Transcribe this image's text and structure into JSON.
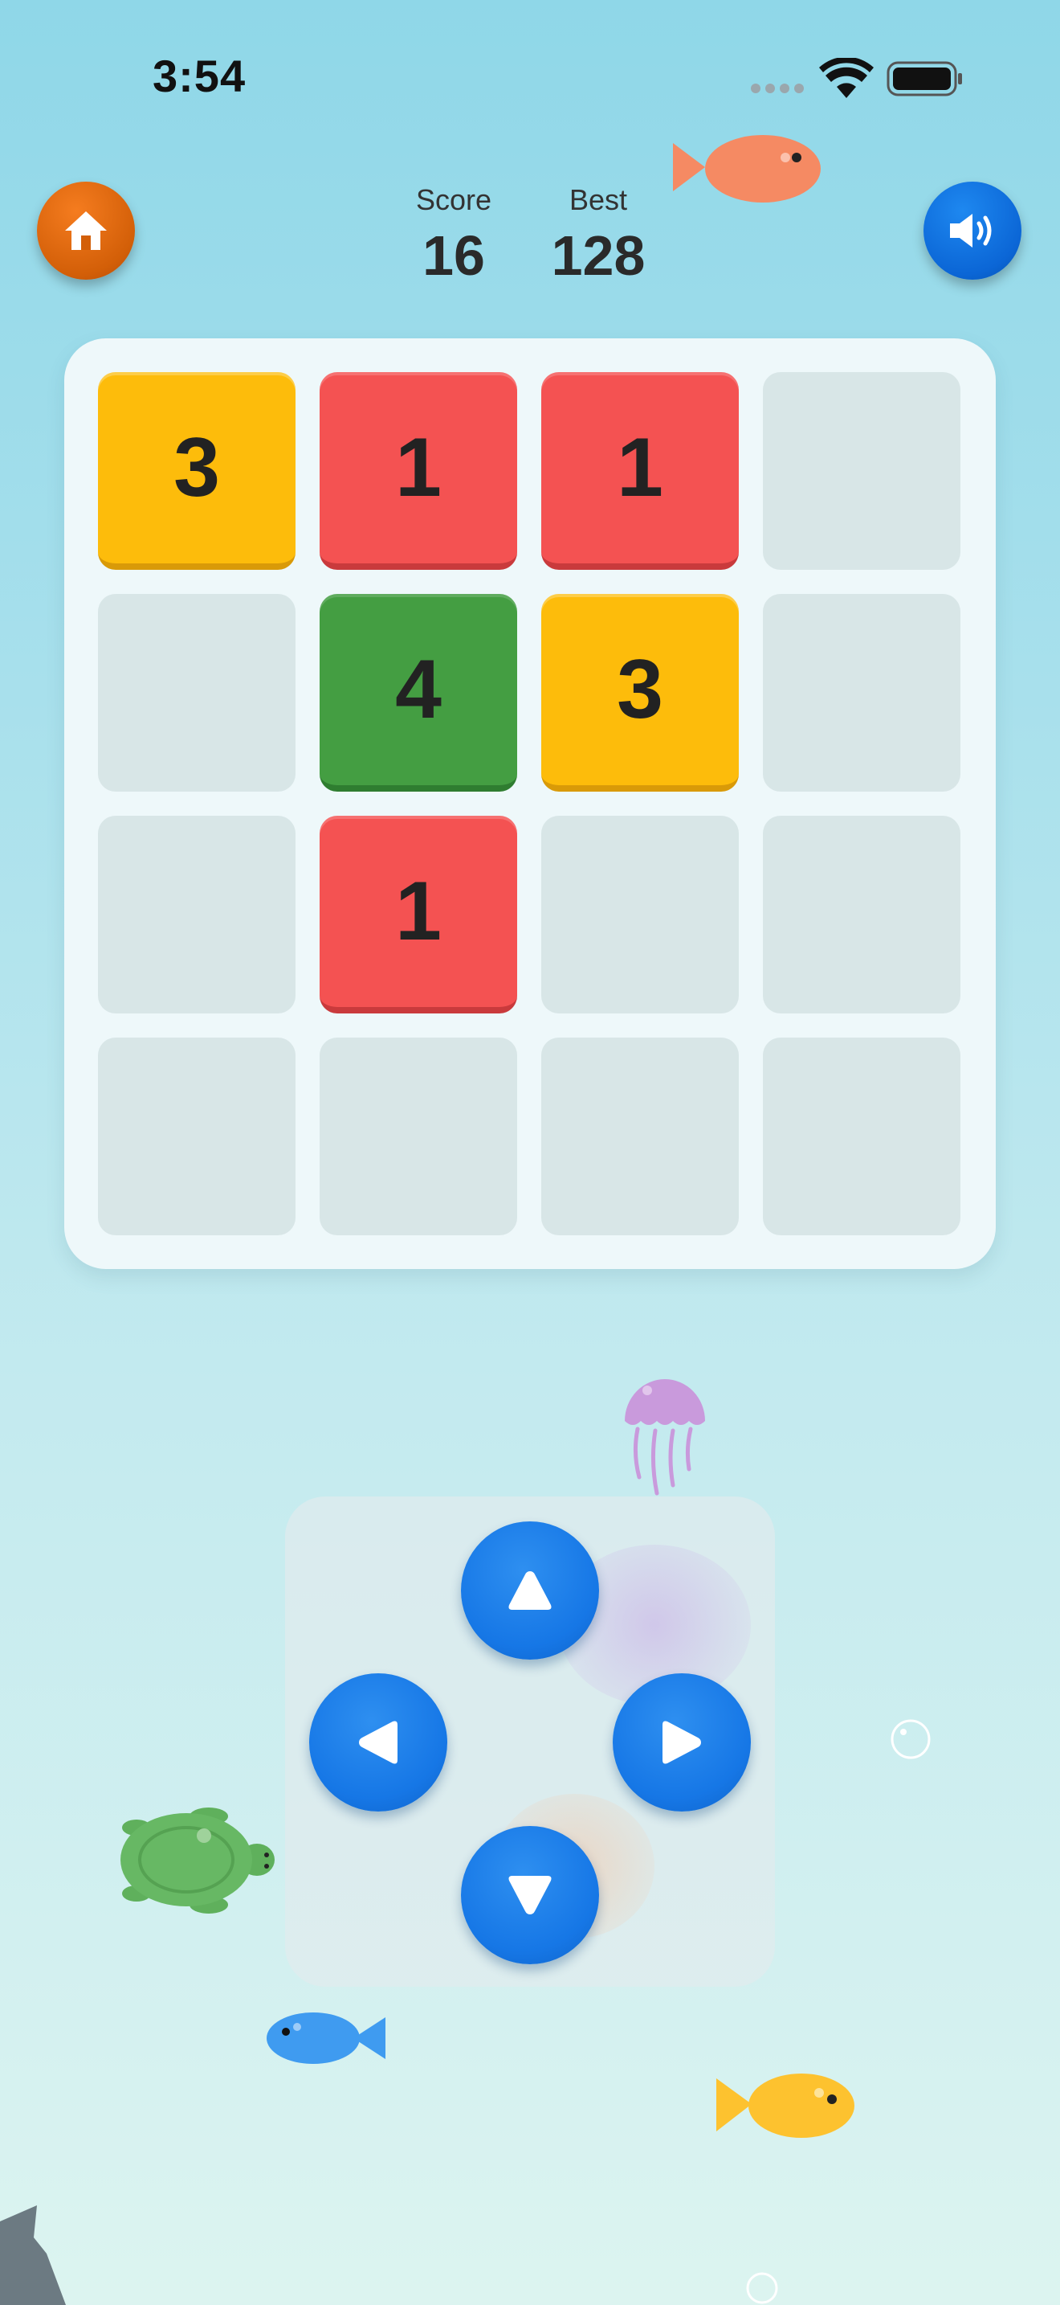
{
  "status_bar": {
    "time": "3:54"
  },
  "header": {
    "score_label": "Score",
    "score_value": "16",
    "best_label": "Best",
    "best_value": "128",
    "home_icon": "home-icon",
    "sound_icon": "speaker-icon"
  },
  "board": {
    "rows": 4,
    "cols": 4,
    "tiles": [
      [
        "3",
        "1",
        "1",
        ""
      ],
      [
        "",
        "4",
        "3",
        ""
      ],
      [
        "",
        "1",
        "",
        ""
      ],
      [
        "",
        "",
        "",
        ""
      ]
    ],
    "tile_colors": {
      "1": "#f45252",
      "3": "#fdbc0b",
      "4": "#449e42"
    },
    "empty_color": "#d8e6e7"
  },
  "controls": {
    "up_icon": "triangle-up-icon",
    "down_icon": "triangle-down-icon",
    "left_icon": "triangle-left-icon",
    "right_icon": "triangle-right-icon"
  },
  "colors": {
    "home_button": "#e06a10",
    "sound_button": "#0b66d6",
    "arrow_button": "#1677e6"
  }
}
